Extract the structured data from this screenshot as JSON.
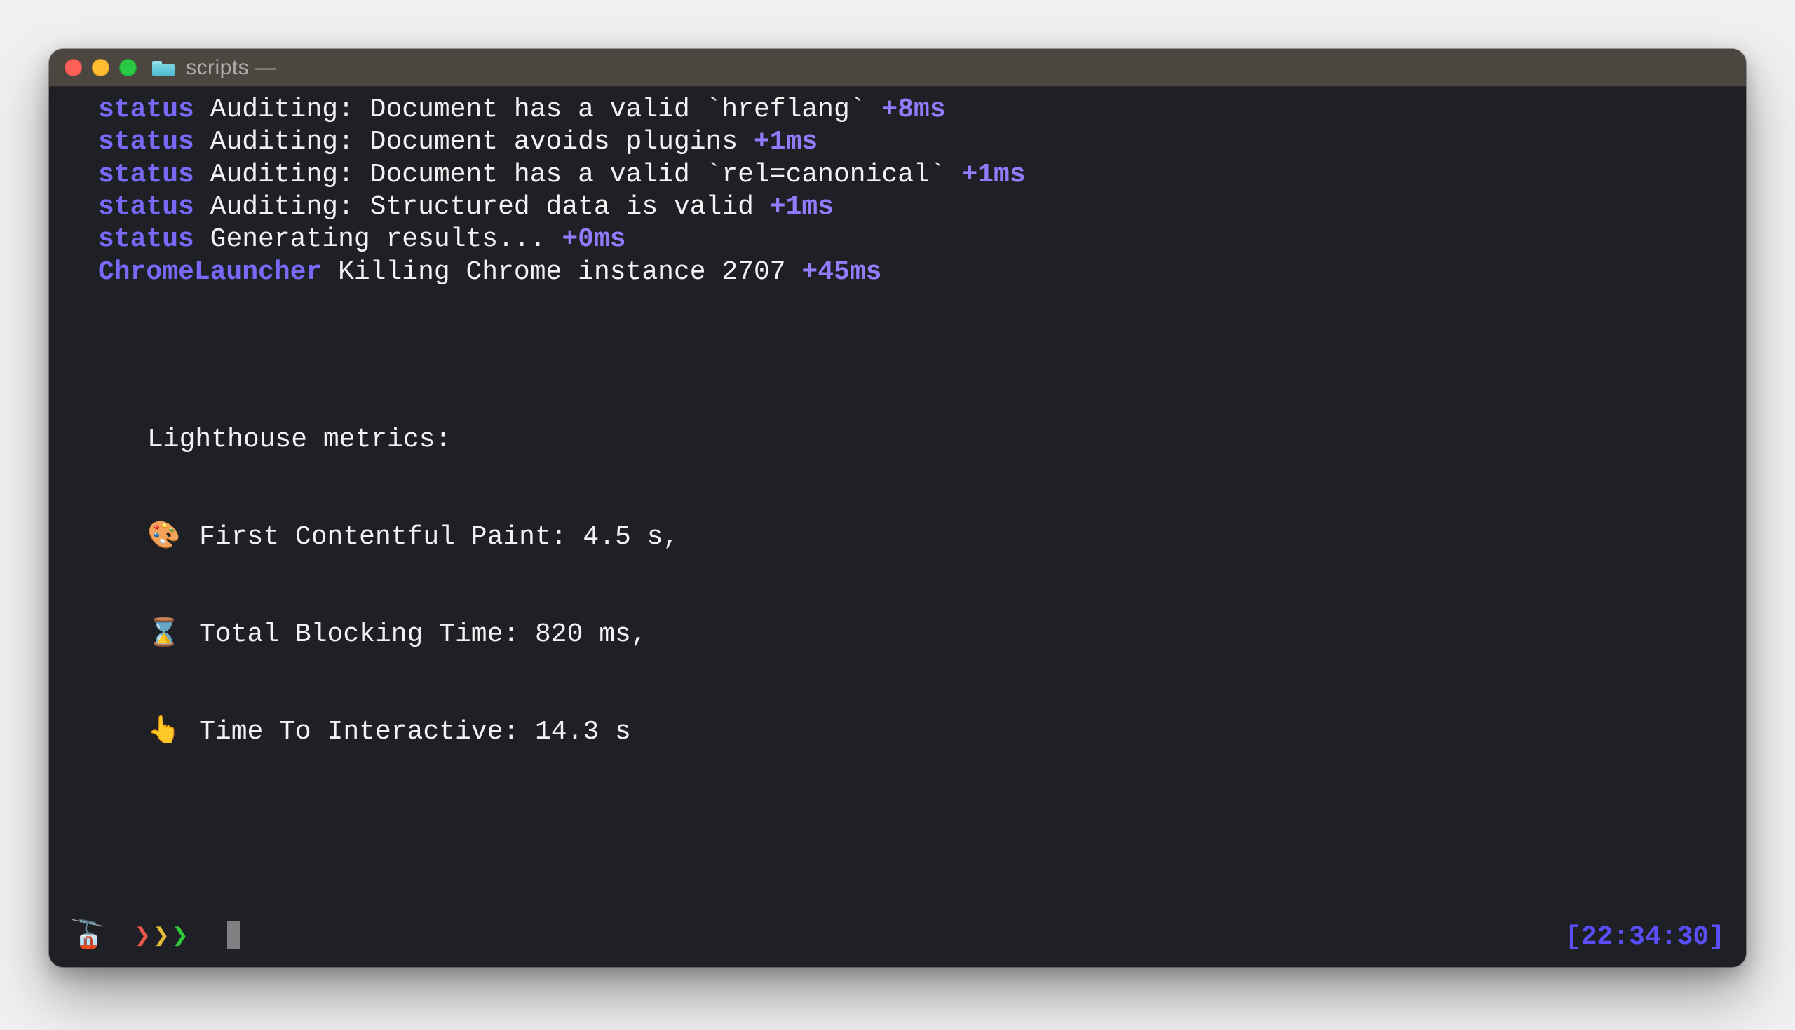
{
  "titlebar": {
    "title": "scripts —"
  },
  "log": [
    {
      "tag": "status",
      "msg": "Auditing: Document has a valid `hreflang`",
      "timing": "+8ms"
    },
    {
      "tag": "status",
      "msg": "Auditing: Document avoids plugins",
      "timing": "+1ms"
    },
    {
      "tag": "status",
      "msg": "Auditing: Document has a valid `rel=canonical`",
      "timing": "+1ms"
    },
    {
      "tag": "status",
      "msg": "Auditing: Structured data is valid",
      "timing": "+1ms"
    },
    {
      "tag": "status",
      "msg": "Generating results...",
      "timing": "+0ms"
    },
    {
      "tag": "ChromeLauncher",
      "msg": "Killing Chrome instance 2707",
      "timing": "+45ms"
    }
  ],
  "metrics": {
    "heading": "Lighthouse metrics:",
    "items": [
      {
        "icon": "🎨",
        "label": "First Contentful Paint:",
        "value": "4.5 s,"
      },
      {
        "icon": "⌛",
        "label": "Total Blocking Time:",
        "value": "820 ms,"
      },
      {
        "icon": "👆",
        "label": "Time To Interactive:",
        "value": "14.3 s"
      }
    ]
  },
  "prompt": {
    "icon": "🚡",
    "chevrons": "❯❯❯",
    "clock": "[22:34:30]"
  }
}
